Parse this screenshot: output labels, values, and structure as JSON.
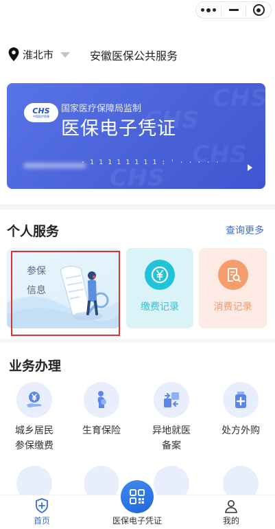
{
  "topbar": {
    "more_icon": "more-dots-icon",
    "minimize_icon": "minimize-icon",
    "close_icon": "target-close-icon"
  },
  "header": {
    "location_icon": "location-pin-icon",
    "city": "淮北市",
    "dropdown_icon": "caret-down-icon",
    "title": "安徽医保公共服务"
  },
  "card": {
    "logo_text": "CHS",
    "logo_sub": "中国医疗保障",
    "subtitle": "国家医疗保障局监制",
    "title": "医保电子凭证",
    "masked_number": "· 1 1 1 1 1 1 1 1 : ' · · · · ·",
    "arrow_icon": "play-arrow-icon",
    "watermark": "CHS",
    "colors": {
      "start": "#5874e6",
      "end": "#3e56cf"
    }
  },
  "personal_services": {
    "title": "个人服务",
    "more": "查询更多",
    "info": {
      "label_line1": "参保",
      "label_line2": "信息",
      "icon": "document-magnifier-illustration"
    },
    "payment": {
      "label": "缴费记录",
      "icon": "yen-coin-icon",
      "color": "#20c3d9"
    },
    "consumption": {
      "label": "消费记录",
      "icon": "receipt-search-icon",
      "color": "#f59c6d"
    }
  },
  "business": {
    "title": "业务办理",
    "items": [
      {
        "line1": "城乡居民",
        "line2": "参保缴费",
        "icon": "hand-yen-icon"
      },
      {
        "line1": "生育保险",
        "line2": "",
        "icon": "maternity-icon"
      },
      {
        "line1": "异地就医",
        "line2": "备案",
        "icon": "transfer-arrows-icon"
      },
      {
        "line1": "处方外购",
        "line2": "",
        "icon": "medicine-bottle-icon"
      }
    ]
  },
  "bottom_nav": {
    "home": "首页",
    "center": "医保电子凭证",
    "mine": "我的",
    "accent": "#2f6ce0"
  }
}
